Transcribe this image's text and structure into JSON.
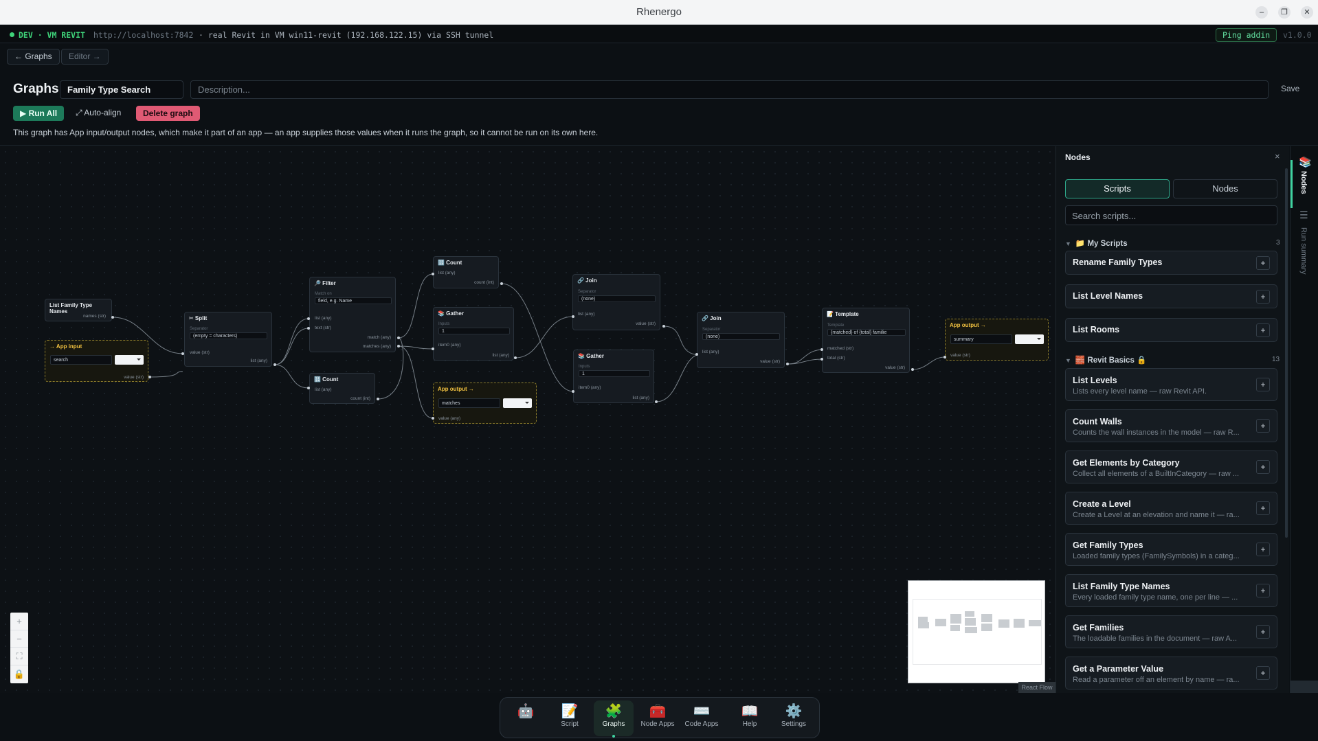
{
  "window": {
    "title": "Rhenergo"
  },
  "devbar": {
    "env": "DEV · VM REVIT",
    "url": "http://localhost:7842",
    "description": "· real Revit in VM win11-revit (192.168.122.15) via SSH tunnel",
    "ping_label": "Ping addin",
    "version": "v1.0.0"
  },
  "nav": {
    "back_label": "← Graphs",
    "editor_label": "Editor →"
  },
  "header": {
    "title": "Graphs",
    "graph_name": "Family Type Search",
    "description_placeholder": "Description...",
    "save_label": "Save",
    "run_all_label": "▶ Run All",
    "auto_align_label": "⤢ Auto-align",
    "delete_label": "Delete graph",
    "notice": "This graph has App input/output nodes, which make it part of an app — an app supplies those values when it runs the graph, so it cannot be run on its own here."
  },
  "graph": {
    "list_family": {
      "title": "List Family Type Names",
      "out": "names (str)"
    },
    "app_input": {
      "title": "→ App input",
      "value": "search",
      "out": "value (str)"
    },
    "split": {
      "title": "✂ Split",
      "sep_label": "Separator",
      "sep_value": "(empty = characters)",
      "in": "value (str)",
      "out": "list (any)"
    },
    "filter": {
      "title": "🔎 Filter",
      "match_label": "Match on",
      "match_placeholder": "field, e.g. Name",
      "in1": "list (any)",
      "in2": "text (str)",
      "out1": "match (any)",
      "out2": "matches (any)"
    },
    "count1": {
      "title": "🔢 Count",
      "in": "list (any)",
      "out": "count (int)"
    },
    "count2": {
      "title": "🔢 Count",
      "in": "list (any)",
      "out": "count (int)"
    },
    "gather1": {
      "title": "📚 Gather",
      "inputs_label": "Inputs",
      "inputs_value": "1",
      "in": "item0 (any)",
      "out": "list (any)"
    },
    "app_output1": {
      "title": "App output →",
      "value": "matches",
      "in": "value (any)"
    },
    "join1": {
      "title": "🔗 Join",
      "sep_label": "Separator",
      "sep_value": "(none)",
      "in": "list (any)",
      "out": "value (str)"
    },
    "gather2": {
      "title": "📚 Gather",
      "inputs_label": "Inputs",
      "inputs_value": "1",
      "in": "item0 (any)",
      "out": "list (any)"
    },
    "join2": {
      "title": "🔗 Join",
      "sep_label": "Separator",
      "sep_value": "(none)",
      "in": "list (any)",
      "out": "value (str)"
    },
    "template": {
      "title": "📝 Template",
      "tpl_label": "Template",
      "tpl_value": "{matched} of {total} familie",
      "in1": "matched (str)",
      "in2": "total (str)",
      "out": "value (str)"
    },
    "app_output2": {
      "title": "App output →",
      "value": "summary",
      "in": "value (str)"
    }
  },
  "zoom_controls": [
    "+",
    "−",
    "⛶",
    "🔒"
  ],
  "minimap_credit": "React Flow",
  "panel": {
    "title": "Nodes",
    "close": "×",
    "tab_scripts": "Scripts",
    "tab_nodes": "Nodes",
    "search_placeholder": "Search scripts...",
    "my_scripts": {
      "label": "My Scripts",
      "icon": "📁",
      "count": "3",
      "items": [
        {
          "title": "Rename Family Types"
        },
        {
          "title": "List Level Names"
        },
        {
          "title": "List Rooms"
        }
      ]
    },
    "revit_basics": {
      "label": "Revit Basics",
      "icon": "🧱",
      "lock": "🔒",
      "count": "13",
      "items": [
        {
          "title": "List Levels",
          "desc": "Lists every level name — raw Revit API."
        },
        {
          "title": "Count Walls",
          "desc": "Counts the wall instances in the model — raw R..."
        },
        {
          "title": "Get Elements by Category",
          "desc": "Collect all elements of a BuiltInCategory — raw ..."
        },
        {
          "title": "Create a Level",
          "desc": "Create a Level at an elevation and name it — ra..."
        },
        {
          "title": "Get Family Types",
          "desc": "Loaded family types (FamilySymbols) in a categ..."
        },
        {
          "title": "List Family Type Names",
          "desc": "Every loaded family type name, one per line — ..."
        },
        {
          "title": "Get Families",
          "desc": "The loadable families in the document — raw A..."
        },
        {
          "title": "Get a Parameter Value",
          "desc": "Read a parameter off an element by name — ra..."
        }
      ]
    },
    "add_label": "+"
  },
  "rail": {
    "nodes_label": "Nodes",
    "run_summary_label": "Run summary"
  },
  "dock": [
    {
      "label": "",
      "icon": "🤖"
    },
    {
      "label": "Script",
      "icon": "📝"
    },
    {
      "label": "Graphs",
      "icon": "🧩"
    },
    {
      "label": "Node Apps",
      "icon": "🧰"
    },
    {
      "label": "Code Apps",
      "icon": "⌨️"
    },
    {
      "label": "Help",
      "icon": "📖"
    },
    {
      "label": "Settings",
      "icon": "⚙️"
    }
  ]
}
